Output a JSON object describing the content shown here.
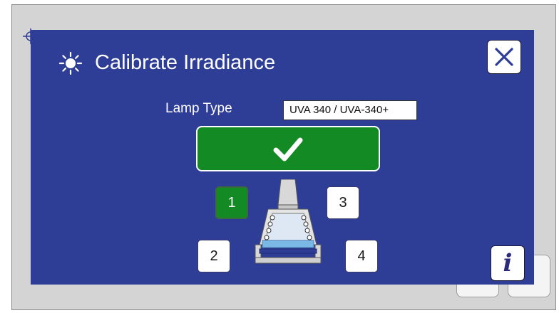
{
  "dialog": {
    "title": "Calibrate Irradiance",
    "title_icon": "sun-icon",
    "close_icon": "close-icon",
    "background_color": "#2e3d96"
  },
  "lamp": {
    "label": "Lamp Type",
    "value": "UVA 340 / UVA-340+"
  },
  "confirm": {
    "icon": "checkmark-icon",
    "color": "#138a24"
  },
  "positions": [
    {
      "label": "1",
      "selected": true
    },
    {
      "label": "3",
      "selected": false
    },
    {
      "label": "2",
      "selected": false
    },
    {
      "label": "4",
      "selected": false
    }
  ],
  "info": {
    "label": "i"
  }
}
